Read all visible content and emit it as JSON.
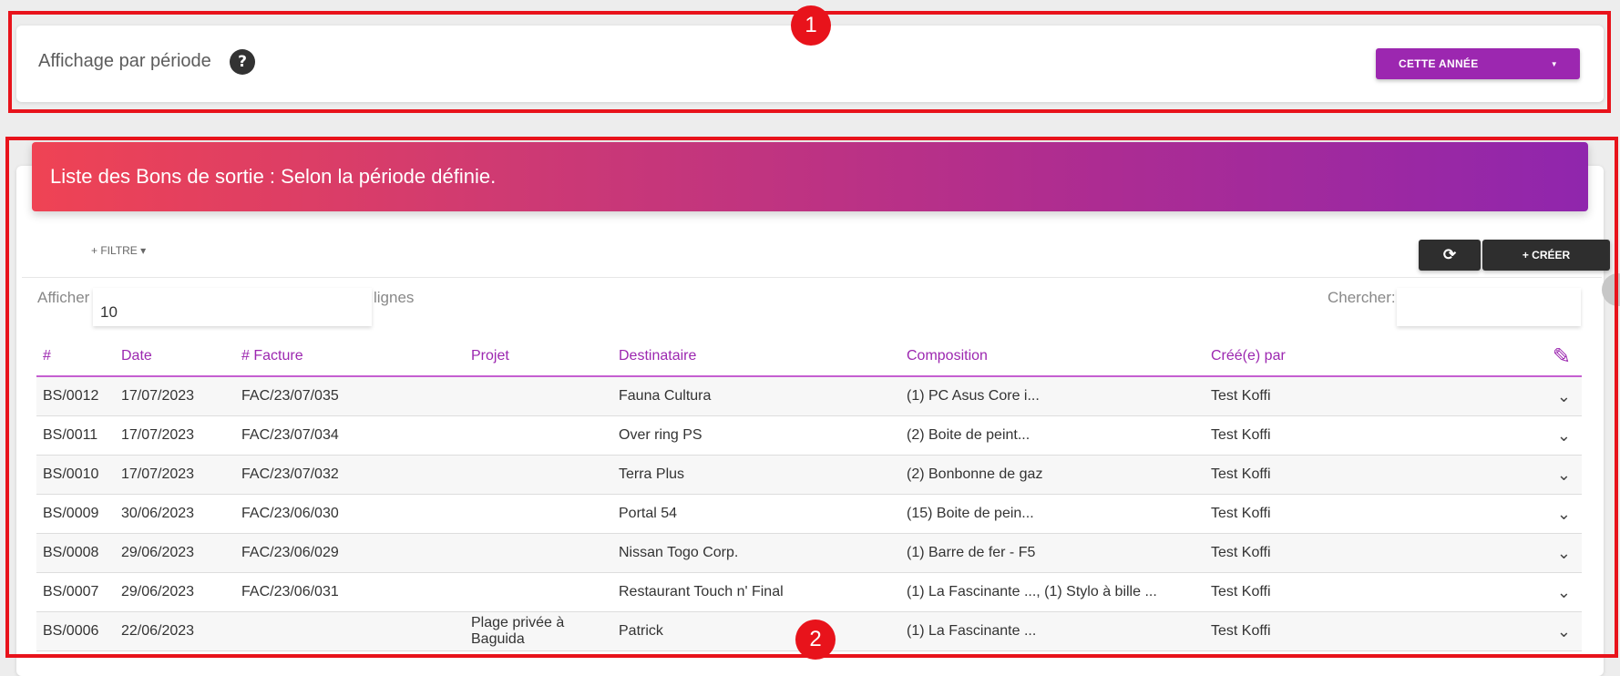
{
  "period": {
    "title": "Affichage par période",
    "help": "?",
    "select_value": "CETTE ANNÉE"
  },
  "list": {
    "header": "Liste des Bons de sortie : Selon la période définie.",
    "filter_label": "+ FILTRE ▾",
    "refresh_icon": "⟳",
    "create_label": "+ CRÉER",
    "show_label": "Afficher",
    "length_value": "10",
    "lines_label": "lignes",
    "search_label": "Chercher:",
    "columns": {
      "num": "#",
      "date": "Date",
      "facture": "# Facture",
      "projet": "Projet",
      "destinataire": "Destinataire",
      "composition": "Composition",
      "creator": "Créé(e) par",
      "edit_icon": "✎"
    },
    "rows": [
      {
        "num": "BS/0012",
        "date": "17/07/2023",
        "facture": "FAC/23/07/035",
        "projet": "",
        "destinataire": "Fauna Cultura",
        "composition": "(1) PC Asus Core i...",
        "creator": "Test Koffi"
      },
      {
        "num": "BS/0011",
        "date": "17/07/2023",
        "facture": "FAC/23/07/034",
        "projet": "",
        "destinataire": "Over ring PS",
        "composition": "(2) Boite de peint...",
        "creator": "Test Koffi"
      },
      {
        "num": "BS/0010",
        "date": "17/07/2023",
        "facture": "FAC/23/07/032",
        "projet": "",
        "destinataire": "Terra Plus",
        "composition": "(2) Bonbonne de gaz",
        "creator": "Test Koffi"
      },
      {
        "num": "BS/0009",
        "date": "30/06/2023",
        "facture": "FAC/23/06/030",
        "projet": "",
        "destinataire": "Portal 54",
        "composition": "(15) Boite de pein...",
        "creator": "Test Koffi"
      },
      {
        "num": "BS/0008",
        "date": "29/06/2023",
        "facture": "FAC/23/06/029",
        "projet": "",
        "destinataire": "Nissan Togo Corp.",
        "composition": "(1) Barre de fer - F5",
        "creator": "Test Koffi"
      },
      {
        "num": "BS/0007",
        "date": "29/06/2023",
        "facture": "FAC/23/06/031",
        "projet": "",
        "destinataire": "Restaurant Touch n' Final",
        "composition": "(1) La Fascinante ..., (1) Stylo à bille ...",
        "creator": "Test Koffi"
      },
      {
        "num": "BS/0006",
        "date": "22/06/2023",
        "facture": "",
        "projet": "Plage privée à Baguida",
        "destinataire": "Patrick",
        "composition": "(1) La Fascinante ...",
        "creator": "Test Koffi"
      }
    ],
    "row_action_icon": "⌄"
  },
  "annotations": {
    "badge_1": "1",
    "badge_2": "2"
  },
  "colors": {
    "accent": "#9c27b0",
    "header_gradient_start": "#ef4354",
    "header_gradient_end": "#9026ad",
    "annotation": "#e8131b"
  }
}
